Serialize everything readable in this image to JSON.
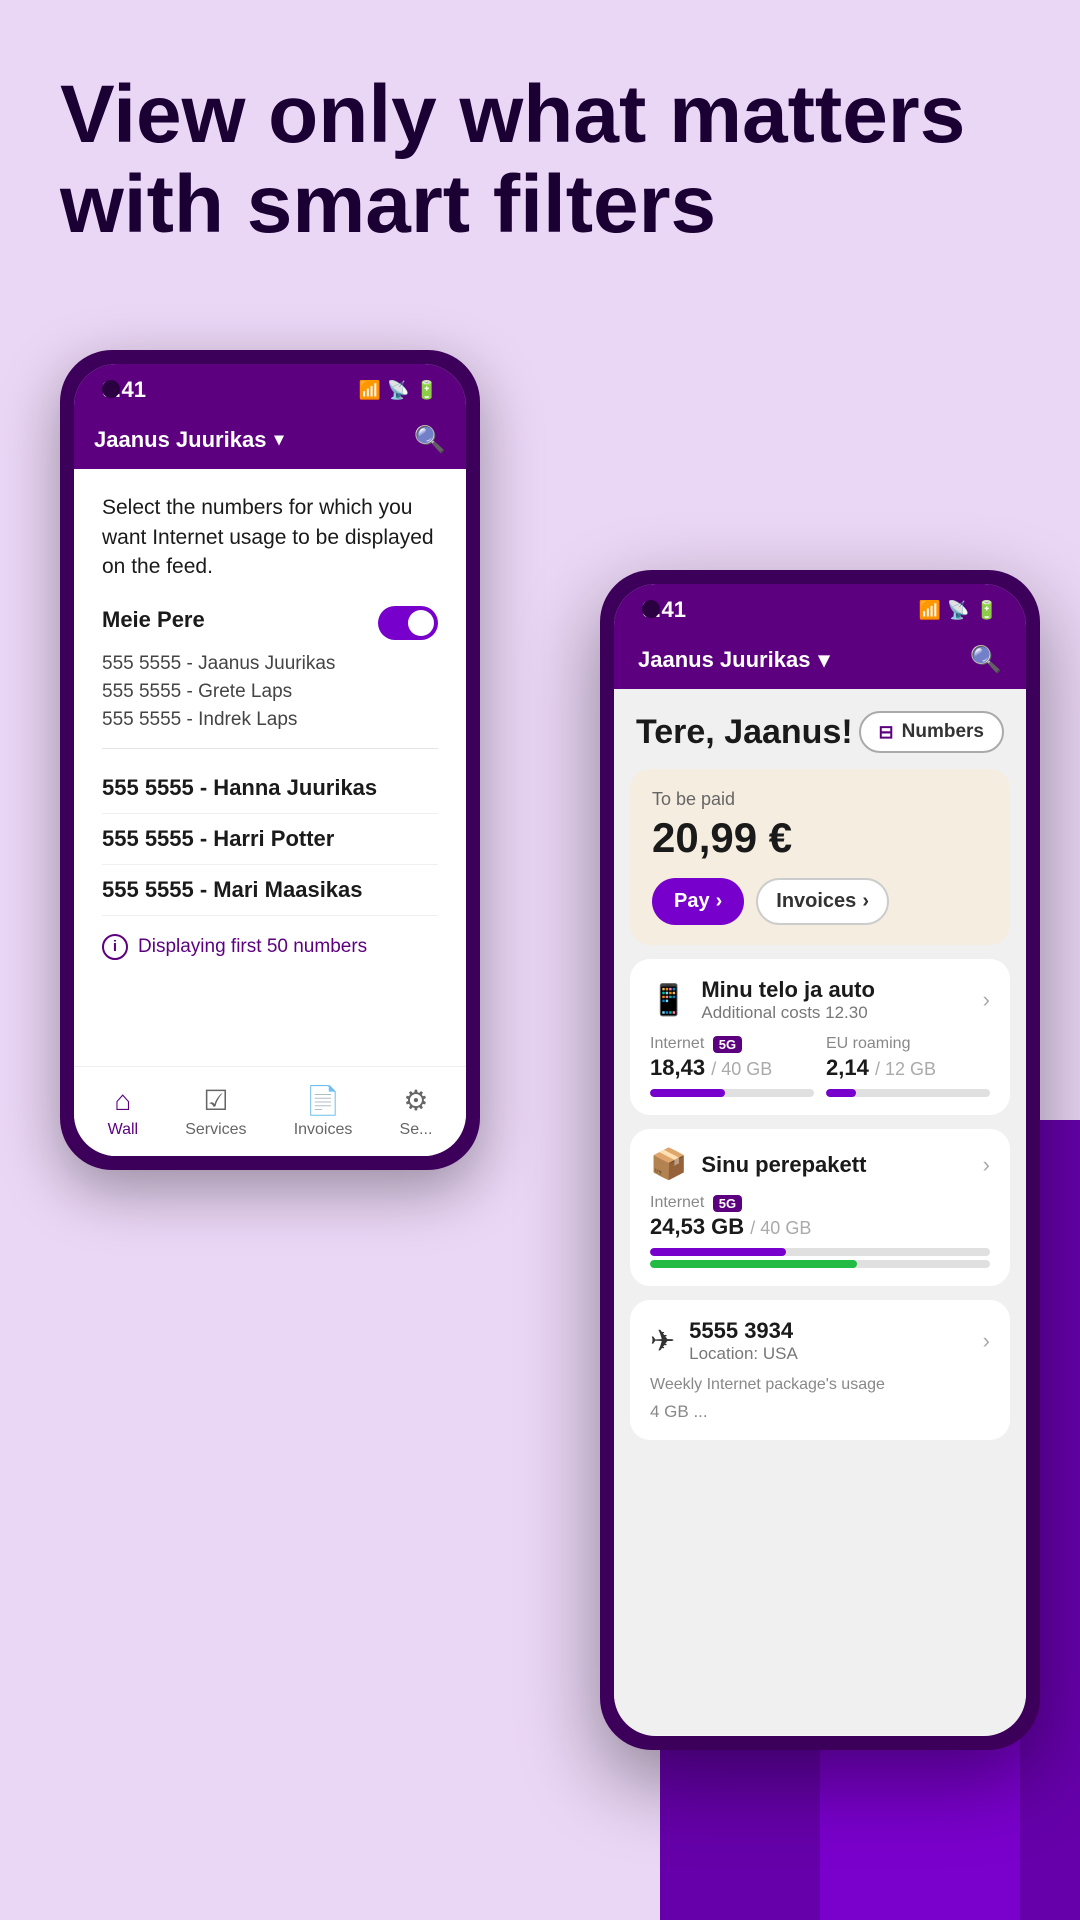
{
  "headline": {
    "text": "View only what matters with smart filters"
  },
  "back_phone": {
    "status_bar": {
      "time": "9:41",
      "signal": "▂▄▆",
      "wifi": "WiFi",
      "battery": "🔋"
    },
    "user_bar": {
      "user_name": "Jaanus Juurikas",
      "chevron": "▾"
    },
    "filter_intro": "Select the numbers for which you want Internet usage to be displayed on the feed.",
    "group_label": "Meie Pere",
    "numbers": [
      "555 5555 - Jaanus Juurikas",
      "555 5555 - Grete Laps",
      "555 5555 - Indrek Laps"
    ],
    "individual_items": [
      "555 5555 - Hanna Juurikas",
      "555 5555 - Harri Potter",
      "555 5555 - Mari Maasikas"
    ],
    "info_text": "Displaying first 50 numbers",
    "nav": {
      "items": [
        {
          "label": "Wall",
          "icon": "⌂",
          "active": true
        },
        {
          "label": "Services",
          "icon": "✓",
          "active": false
        },
        {
          "label": "Invoices",
          "icon": "📄",
          "active": false
        },
        {
          "label": "Se...",
          "icon": "⚙",
          "active": false
        }
      ]
    }
  },
  "front_phone": {
    "status_bar": {
      "time": "9:41",
      "signal": "▂▄▆",
      "wifi": "WiFi",
      "battery": "🔋"
    },
    "user_bar": {
      "user_name": "Jaanus Juurikas",
      "chevron": "▾"
    },
    "greeting": "Tere, Jaanus!",
    "numbers_button": "Numbers",
    "payment_card": {
      "label": "To be paid",
      "amount": "20,99 €",
      "pay_btn": "Pay",
      "invoices_btn": "Invoices"
    },
    "service_card_1": {
      "title": "Minu telo ja auto",
      "subtitle": "Additional costs 12.30",
      "internet_label": "Internet",
      "badge_5g": "5G",
      "internet_value": "18,43",
      "internet_total": "/ 40 GB",
      "internet_pct": 46,
      "eu_label": "EU roaming",
      "eu_value": "2,14",
      "eu_total": "/ 12 GB",
      "eu_pct": 18
    },
    "service_card_2": {
      "title": "Sinu perepakett",
      "internet_label": "Internet",
      "badge_5g": "5G",
      "internet_value": "24,53 GB",
      "internet_total": "/ 40 GB",
      "internet_pct": 61
    },
    "service_card_3": {
      "number": "5555 3934",
      "location": "Location: USA",
      "weekly_label": "Weekly Internet package's usage",
      "partial_value": "4 GB ..."
    }
  }
}
